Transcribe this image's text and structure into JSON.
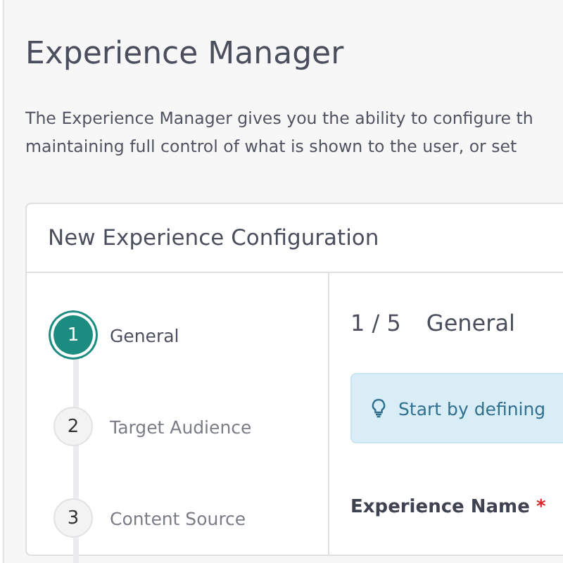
{
  "page": {
    "title": "Experience Manager",
    "description_lines": [
      "The Experience Manager gives you the ability to configure th",
      "maintaining full control of what is shown to the user, or set"
    ]
  },
  "card": {
    "title": "New Experience Configuration",
    "steps": [
      {
        "number": "1",
        "label": "General",
        "selected": true
      },
      {
        "number": "2",
        "label": "Target Audience",
        "selected": false
      },
      {
        "number": "3",
        "label": "Content Source",
        "selected": false
      }
    ],
    "step_counter": "1 / 5",
    "step_title": "General",
    "alert": {
      "text": "Start by defining"
    },
    "field": {
      "label": "Experience Name",
      "required_mark": "*"
    }
  }
}
